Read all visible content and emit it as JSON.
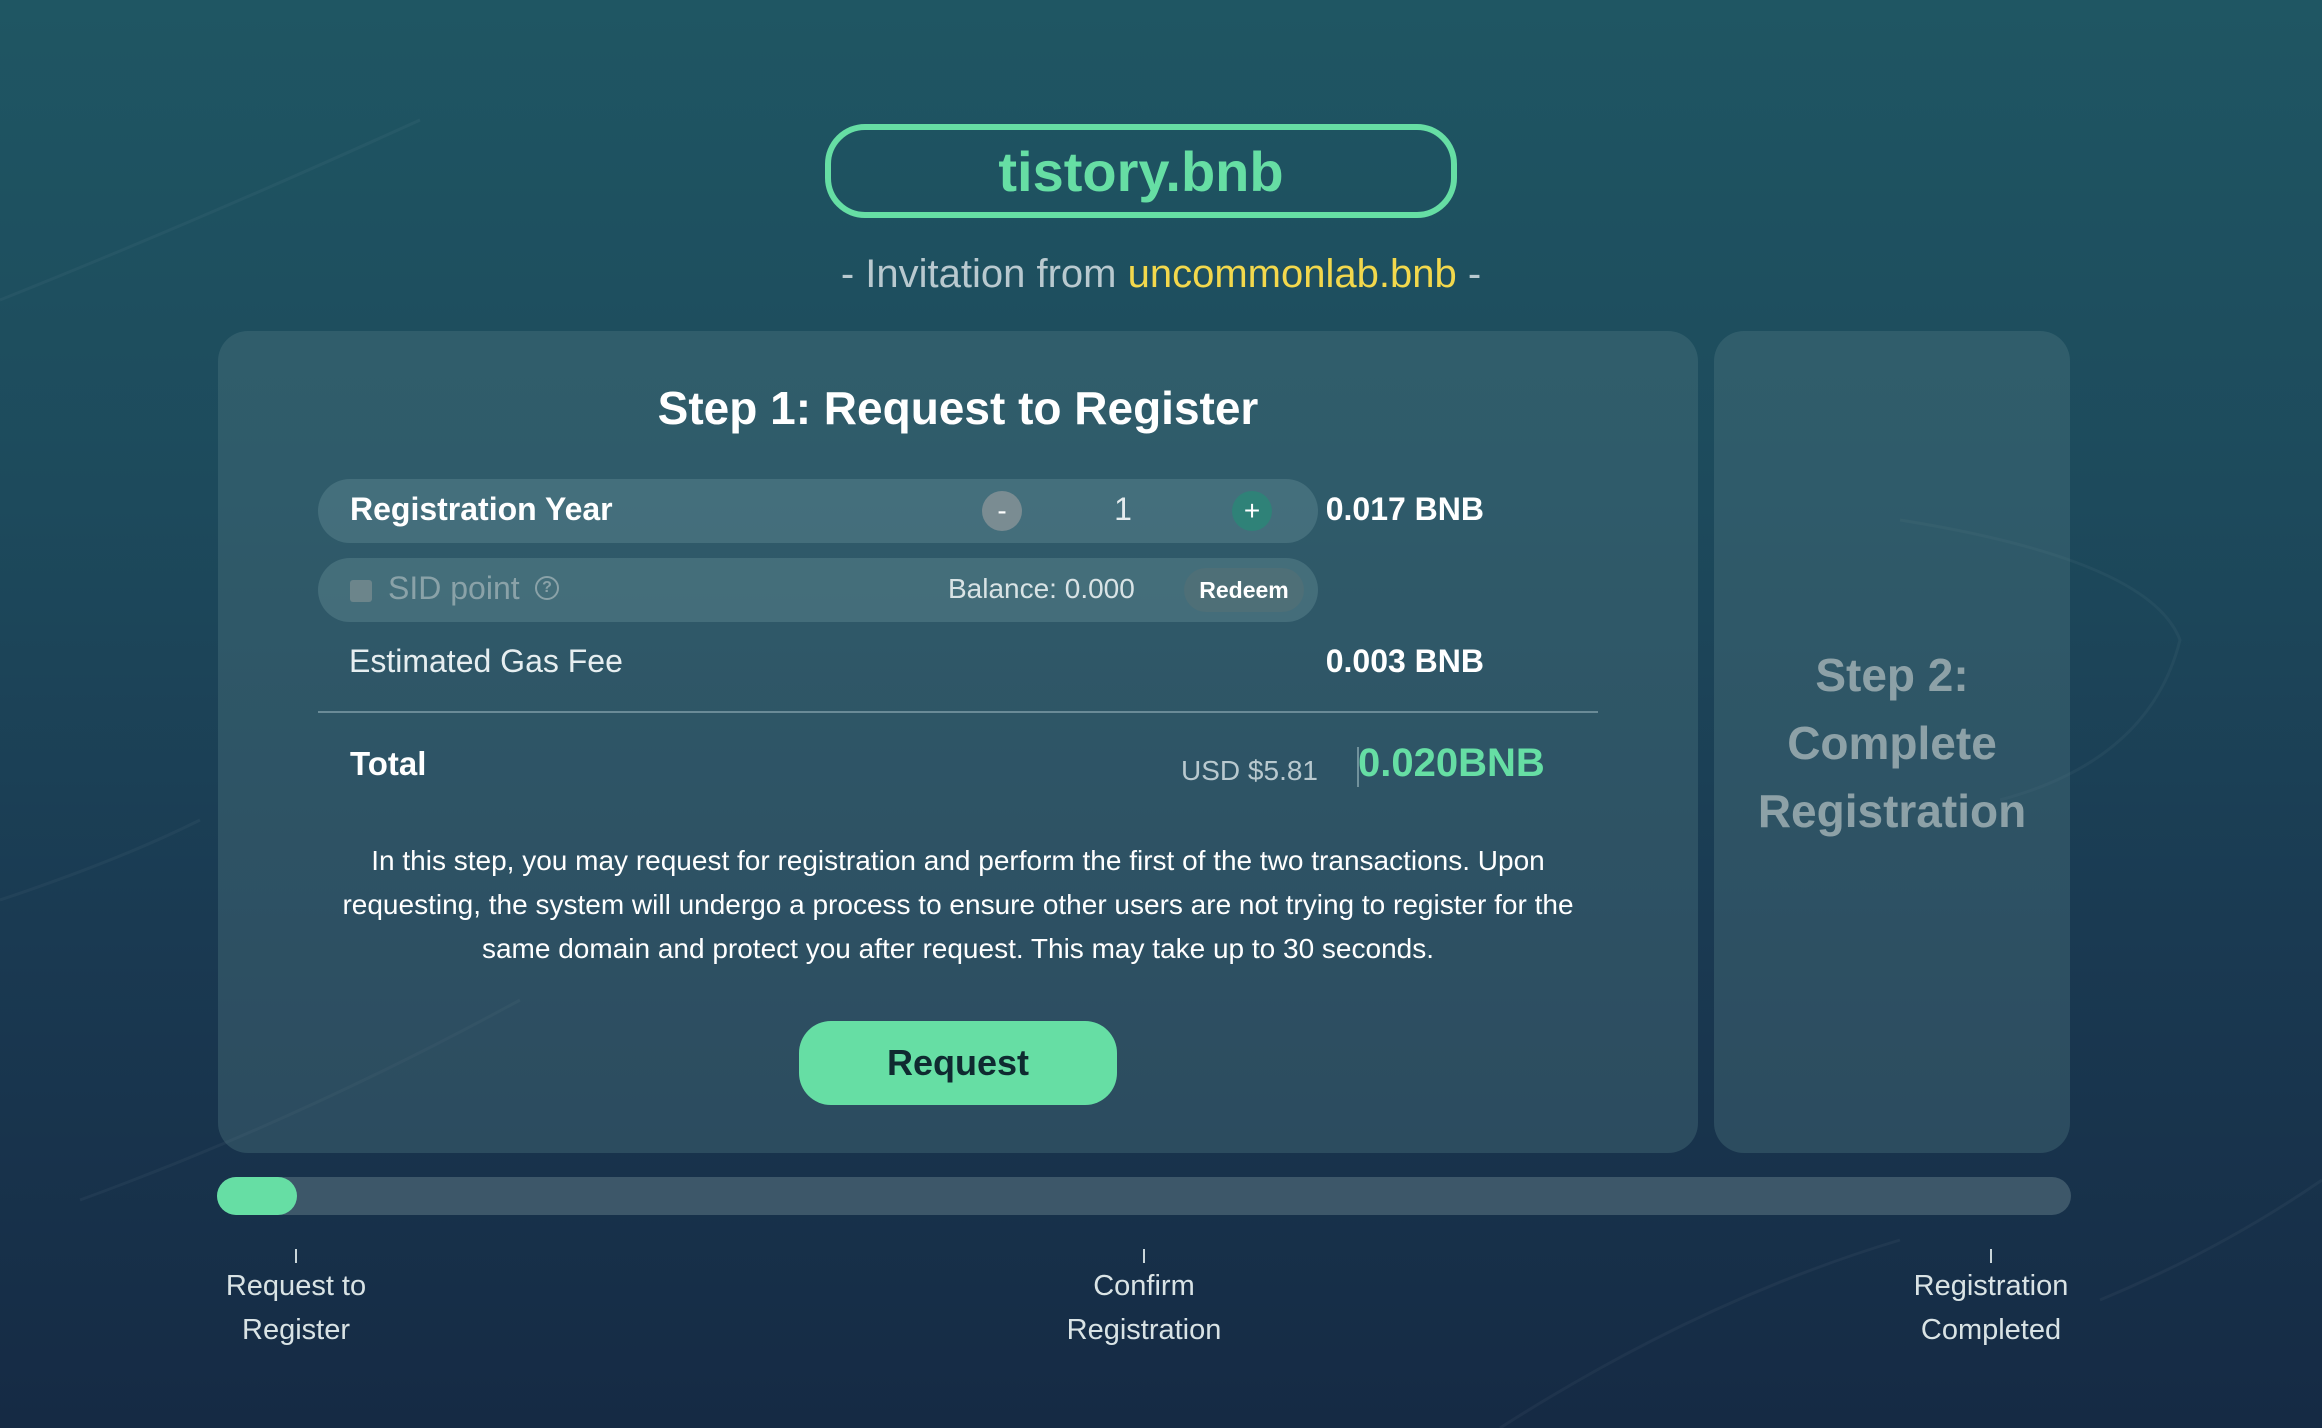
{
  "domain": "tistory.bnb",
  "invitation": {
    "prefix": "- Invitation from",
    "inviter": "uncommonlab.bnb",
    "suffix": "-"
  },
  "step1": {
    "title": "Step 1: Request to Register",
    "registration_year": {
      "label": "Registration Year",
      "decrement_label": "-",
      "increment_label": "+",
      "value": "1",
      "price": "0.017 BNB"
    },
    "sid_point": {
      "label": "SID point",
      "checked": false,
      "help_icon": "question-circle-icon",
      "balance_label": "Balance: 0.000",
      "redeem_label": "Redeem"
    },
    "gas_fee": {
      "label": "Estimated Gas Fee",
      "value": "0.003 BNB"
    },
    "total": {
      "label": "Total",
      "usd": "USD $5.81",
      "bnb": "0.020BNB"
    },
    "description": "In this step, you may request for registration and perform the first of the two transactions. Upon requesting, the system will undergo a process to ensure other users are not trying to register for the same domain and protect you after request. This may take up to 30 seconds.",
    "request_label": "Request"
  },
  "step2": {
    "title": "Step 2: Complete Registration"
  },
  "progress": {
    "fraction": 0.03,
    "milestones": [
      {
        "label": "Request to\nRegister"
      },
      {
        "label": "Confirm\nRegistration"
      },
      {
        "label": "Registration\nCompleted"
      }
    ]
  },
  "colors": {
    "accent": "#66dea4",
    "inviter": "#f3d84c",
    "muted": "#8da1a7"
  }
}
